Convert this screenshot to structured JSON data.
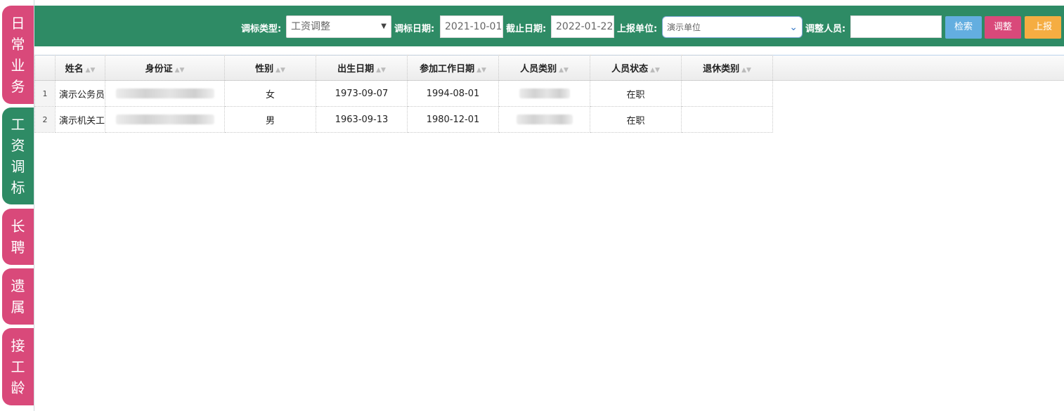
{
  "side_tabs": [
    {
      "label": "日常业务",
      "color": "#d9497a"
    },
    {
      "label": "工资调标",
      "color": "#2e8b65"
    },
    {
      "label": "长聘",
      "color": "#d9497a"
    },
    {
      "label": "遗属",
      "color": "#d9497a"
    },
    {
      "label": "接工龄",
      "color": "#d9497a"
    }
  ],
  "toolbar": {
    "type_label": "调标类型:",
    "type_value": "工资调整",
    "date_label": "调标日期:",
    "date_value": "2021-10-01",
    "end_label": "截止日期:",
    "end_value": "2022-01-22",
    "unit_label": "上报单位:",
    "unit_value": "演示单位",
    "person_label": "调整人员:",
    "person_value": "",
    "search_btn": "检索",
    "adjust_btn": "调整",
    "report_btn": "上报",
    "colors": {
      "bar": "#2e8b65",
      "search": "#63aee0",
      "adjust": "#d9497a",
      "report": "#f5ad42"
    }
  },
  "table": {
    "columns": [
      "姓名",
      "身份证",
      "性别",
      "出生日期",
      "参加工作日期",
      "人员类别",
      "人员状态",
      "退休类别"
    ],
    "rows": [
      {
        "no": "1",
        "name": "演示公务员",
        "id": "",
        "gender": "女",
        "birth": "1973-09-07",
        "work": "1994-08-01",
        "category": "",
        "status": "在职",
        "retire": ""
      },
      {
        "no": "2",
        "name": "演示机关工",
        "id": "",
        "gender": "男",
        "birth": "1963-09-13",
        "work": "1980-12-01",
        "category": "",
        "status": "在职",
        "retire": ""
      }
    ]
  }
}
